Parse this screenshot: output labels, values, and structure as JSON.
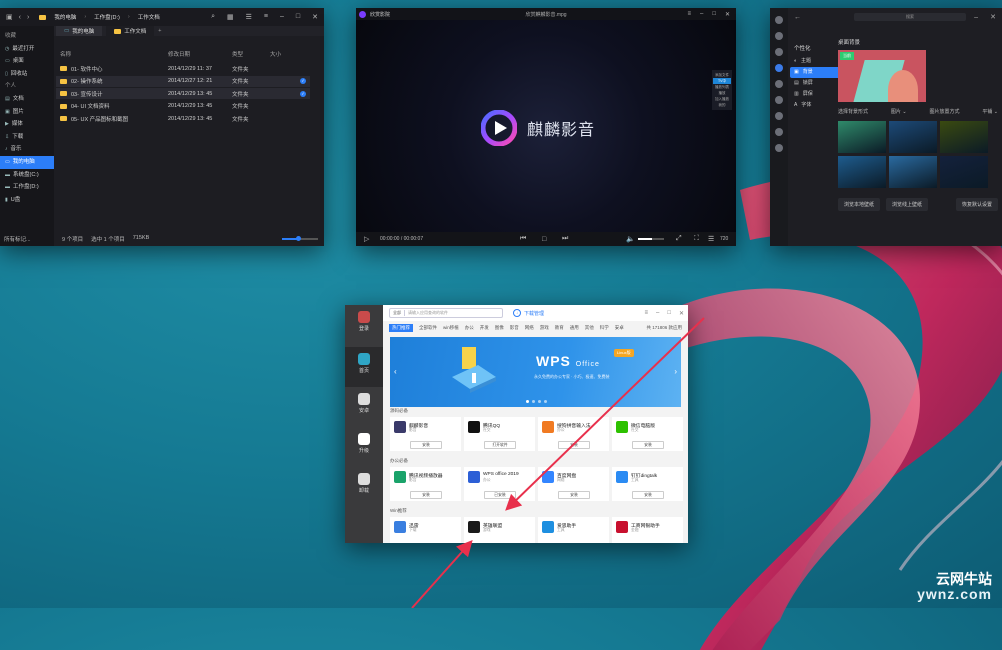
{
  "file_manager": {
    "breadcrumb": [
      "我的电脑",
      "工作盘(D:)",
      "工作文档"
    ],
    "tabs": [
      "我的电脑",
      "工作文档"
    ],
    "sidebar": [
      {
        "label": "收藏",
        "header": true
      },
      {
        "label": "最近打开",
        "icon": "clock-icon"
      },
      {
        "label": "桌面",
        "icon": "desktop-icon"
      },
      {
        "label": "回收站",
        "icon": "trash-icon"
      },
      {
        "label": "个人",
        "header": true
      },
      {
        "label": "文档",
        "icon": "document-icon"
      },
      {
        "label": "图片",
        "icon": "image-icon"
      },
      {
        "label": "媒体",
        "icon": "video-icon"
      },
      {
        "label": "下载",
        "icon": "download-icon"
      },
      {
        "label": "音乐",
        "icon": "music-icon"
      },
      {
        "label": "我的电脑",
        "active": true,
        "icon": "computer-icon"
      },
      {
        "label": "系统盘(C:)",
        "icon": "disk-icon"
      },
      {
        "label": "工作盘(D:)",
        "icon": "disk-icon"
      },
      {
        "label": "U盘",
        "icon": "usb-icon"
      }
    ],
    "sidebar_footer": "所有标记...",
    "columns": [
      "名称",
      "修改日期",
      "类型",
      "大小"
    ],
    "rows": [
      {
        "name": "01- 软件中心",
        "date": "2014/12/29 11: 37",
        "type": "文件夹",
        "selected": false
      },
      {
        "name": "02- 操作系统",
        "date": "2014/12/27 12: 21",
        "type": "文件夹",
        "selected": true
      },
      {
        "name": "03- 宣传设计",
        "date": "2014/12/29 13: 45",
        "type": "文件夹",
        "selected": true
      },
      {
        "name": "04- UI 文档资料",
        "date": "2014/12/29 13: 45",
        "type": "文件夹",
        "selected": false
      },
      {
        "name": "05- UX 产品图标和截图",
        "date": "2014/12/29 13: 45",
        "type": "文件夹",
        "selected": false
      }
    ],
    "status": {
      "count": "9 个项目",
      "selected": "选中 1 个项目",
      "size": "715KB"
    },
    "zoom_fraction": 0.45
  },
  "video_player": {
    "app_name": "欣赏影院",
    "file_name": "欣赏麒麟影音.mpg",
    "brand": "麒麟影音",
    "side_items": [
      "添加文件",
      "TV中",
      "播放列表",
      "播放",
      "加入播放",
      "我的"
    ],
    "time": "00:00:00 / 00:00:07",
    "speed": "720"
  },
  "control_center": {
    "search": "搜索",
    "section": "个性化",
    "menu": [
      {
        "label": "主题",
        "active": false,
        "icon": "theme-icon"
      },
      {
        "label": "背景",
        "active": true,
        "icon": "background-icon"
      },
      {
        "label": "锁屏",
        "active": false,
        "icon": "lockscreen-icon"
      },
      {
        "label": "屏保",
        "active": false,
        "icon": "screensaver-icon"
      },
      {
        "label": "字体",
        "active": false,
        "icon": "font-icon"
      }
    ],
    "title": "桌面背景",
    "preview_tag": "当前",
    "option1_label": "选择背景形式",
    "option1_value": "图片",
    "option2_label": "图片放置方式",
    "option2_value": "平铺",
    "thumbs": [
      "#2f8a6a",
      "#1d4a78",
      "#3a4a10",
      "#1e5c8e",
      "#2a6aa0",
      "#14213c"
    ],
    "buttons": [
      "浏览本地壁纸",
      "浏览线上壁纸",
      "恢复默认设置"
    ]
  },
  "app_store": {
    "nav": [
      {
        "label": "登录",
        "icon": "avatar-icon",
        "color": "#c94b4b"
      },
      {
        "label": "首页",
        "icon": "store-icon",
        "color": "#2fa6c6",
        "active": true
      },
      {
        "label": "安卓",
        "icon": "android-icon",
        "color": "#dddddd"
      },
      {
        "label": "升级",
        "icon": "upgrade-icon",
        "color": "#ffffff"
      },
      {
        "label": "卸载",
        "icon": "uninstall-icon",
        "color": "#dddddd"
      }
    ],
    "search_scope": "全部",
    "search_placeholder": "请输入应用查询的软件",
    "upload": "下载管理",
    "categories": [
      "热门推荐",
      "全部软件",
      "win移植",
      "办公",
      "开发",
      "图像",
      "影音",
      "网络",
      "游戏",
      "教育",
      "通用",
      "其他",
      "科学",
      "安卓"
    ],
    "count": "共 171806 款应用",
    "banner": {
      "title": "WPS",
      "suffix": "Office",
      "badge": "Linux版",
      "subtitle": "永久免费的办公专家 · 小巧、极速、免费装"
    },
    "sections": [
      {
        "title": "源码必备",
        "apps": [
          {
            "name": "麒麟影音",
            "category": "影音",
            "button": "安装",
            "color": "#3a3a6a"
          },
          {
            "name": "腾讯QQ",
            "category": "社交",
            "button": "打开软件",
            "color": "#111111"
          },
          {
            "name": "搜狗拼音输入法",
            "category": "办公",
            "button": "安装",
            "color": "#f07a22"
          },
          {
            "name": "微信电脑版",
            "category": "社交",
            "button": "安装",
            "color": "#2dc100"
          }
        ]
      },
      {
        "title": "办公必备",
        "apps": [
          {
            "name": "腾讯视频播放器",
            "category": "影音",
            "button": "安装",
            "color": "#1aa36a"
          },
          {
            "name": "WPS office 2019",
            "category": "办公",
            "button": "已安装",
            "color": "#2c5fd6"
          },
          {
            "name": "百度网盘",
            "category": "网络",
            "button": "安装",
            "color": "#3385ff"
          },
          {
            "name": "钉钉dingtalk",
            "category": "工具",
            "button": "安装",
            "color": "#2b8bf3"
          }
        ]
      },
      {
        "title": "Win推荐",
        "apps": [
          {
            "name": "迅雷",
            "category": "下载",
            "button": "",
            "color": "#3a7fe0"
          },
          {
            "name": "英雄联盟",
            "category": "游戏",
            "button": "",
            "color": "#1a1a1a"
          },
          {
            "name": "爱思助手",
            "category": "工具",
            "button": "",
            "color": "#1e8fe0"
          },
          {
            "name": "工商网银助手",
            "category": "金融",
            "button": "",
            "color": "#c8102e"
          }
        ]
      }
    ]
  },
  "watermark": {
    "line1": "云网牛站",
    "line2": "ywnz.com"
  },
  "colors": {
    "accent": "#2c7ef8",
    "arrow": "#e8304c",
    "desktop": "#157a93"
  }
}
